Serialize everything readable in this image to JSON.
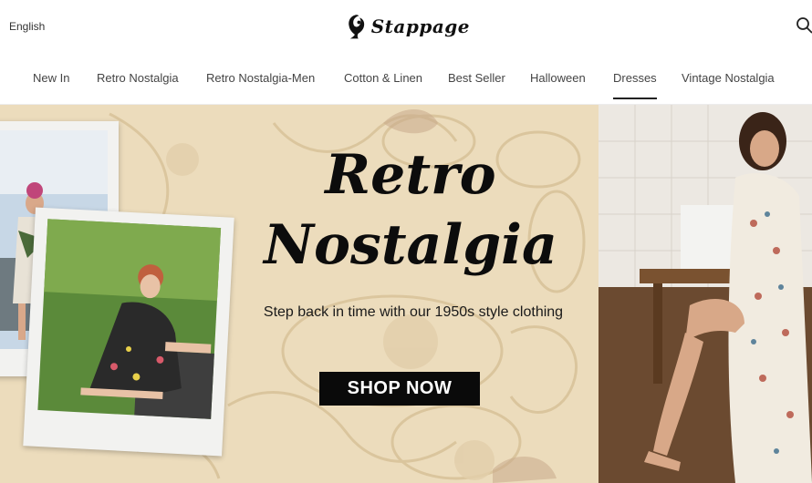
{
  "header": {
    "language": "English",
    "logo_text": "Stappage",
    "search_icon": "search-icon"
  },
  "nav": {
    "items": [
      {
        "label": "New In"
      },
      {
        "label": "Retro Nostalgia"
      },
      {
        "label": "Retro Nostalgia-Men"
      },
      {
        "label": "Cotton & Linen"
      },
      {
        "label": "Best Seller"
      },
      {
        "label": "Halloween"
      },
      {
        "label": "Dresses",
        "active": true
      },
      {
        "label": "Vintage Nostalgia"
      }
    ]
  },
  "hero": {
    "title_line1": "Retro",
    "title_line2": "Nostalgia",
    "subtitle": "Step back in time with our 1950s style clothing",
    "cta": "SHOP NOW"
  },
  "colors": {
    "hero_bg": "#ecdcbc",
    "cta_bg": "#0a0a0a",
    "text": "#333333"
  }
}
